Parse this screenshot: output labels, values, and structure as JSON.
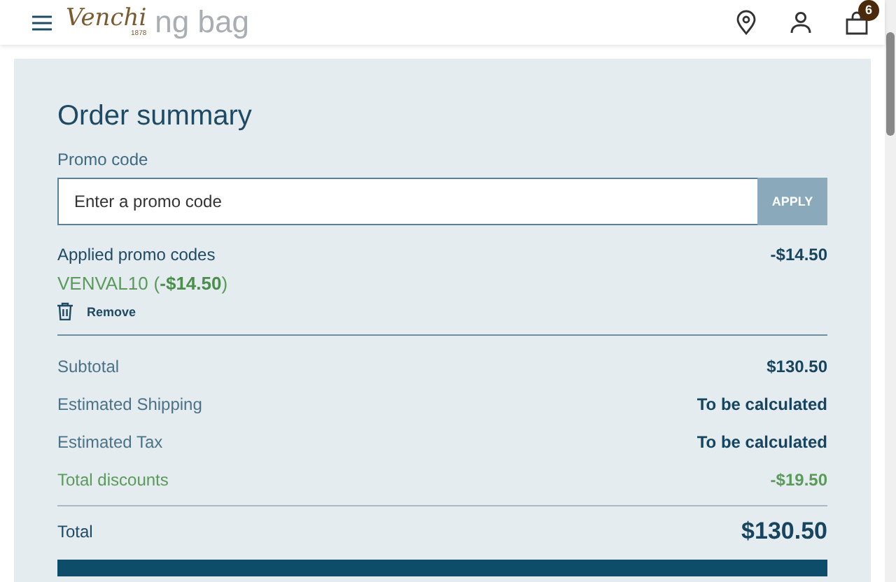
{
  "header": {
    "logo": "Venchi",
    "logo_year": "1878",
    "page_title": "ng bag",
    "cart_count": "6"
  },
  "summary": {
    "title": "Order summary",
    "promo_label": "Promo code",
    "promo_placeholder": "Enter a promo code",
    "apply": "APPLY",
    "applied_label": "Applied promo codes",
    "applied_amount": "-$14.50",
    "code": "VENVAL10",
    "code_amount": "(**-$14.50**)",
    "remove": "Remove",
    "rows": [
      {
        "kind": "normal",
        "label": "Subtotal",
        "value": "$130.50"
      },
      {
        "kind": "normal",
        "label": "Estimated Shipping",
        "value": "To be calculated"
      },
      {
        "kind": "normal",
        "label": "Estimated Tax",
        "value": "To be calculated"
      },
      {
        "kind": "discount",
        "label": "Total discounts",
        "value": "-$19.50"
      }
    ],
    "total_label": "Total",
    "total_value": "$130.50"
  }
}
